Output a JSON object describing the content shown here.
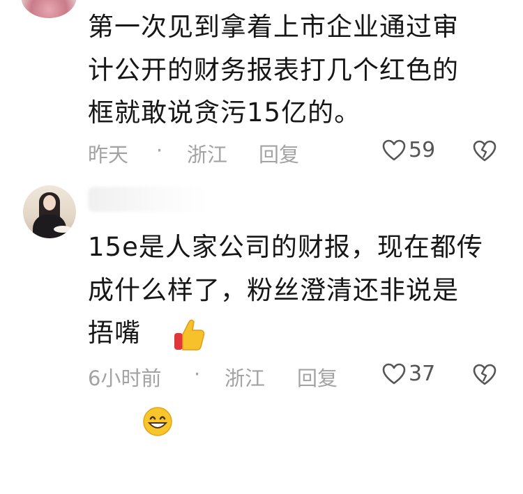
{
  "comment1": {
    "lines": [
      "第一次见到拿着上市企业通过审",
      "计公开的财务报表打几个红色的",
      "框就敢说贪污15亿的。"
    ],
    "time": "昨天",
    "separator": "·",
    "location": "浙江",
    "reply_label": "回复",
    "likes": "59"
  },
  "comment2": {
    "lines": [
      "15e是人家公司的财报，现在都传",
      "成什么样了，粉丝澄清还非说是",
      "捂嘴"
    ],
    "emojis": [
      "grinning-face-emoji",
      "thumbs-up-emoji"
    ],
    "time": "6小时前",
    "separator": "·",
    "location": "浙江",
    "reply_label": "回复",
    "likes": "37"
  },
  "icons": {
    "like": "heart-outline-icon",
    "dislike": "broken-heart-icon"
  },
  "colors": {
    "text": "#161616",
    "meta": "#a3a3a3",
    "background": "#ffffff"
  }
}
